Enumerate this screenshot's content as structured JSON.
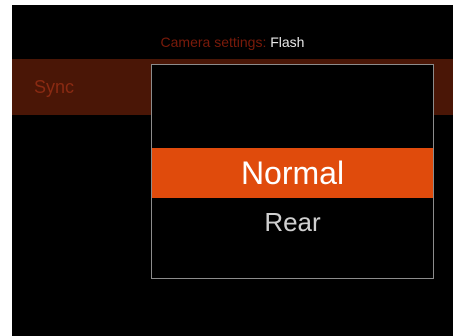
{
  "header": {
    "prefix": "Camera settings:",
    "value": "Flash"
  },
  "setting": {
    "label": "Sync"
  },
  "popup": {
    "options": [
      {
        "label": "Normal",
        "selected": true
      },
      {
        "label": "Rear",
        "selected": false
      }
    ]
  },
  "colors": {
    "accent": "#e04b0c",
    "row_highlight": "#4a1606",
    "background": "#000000"
  }
}
